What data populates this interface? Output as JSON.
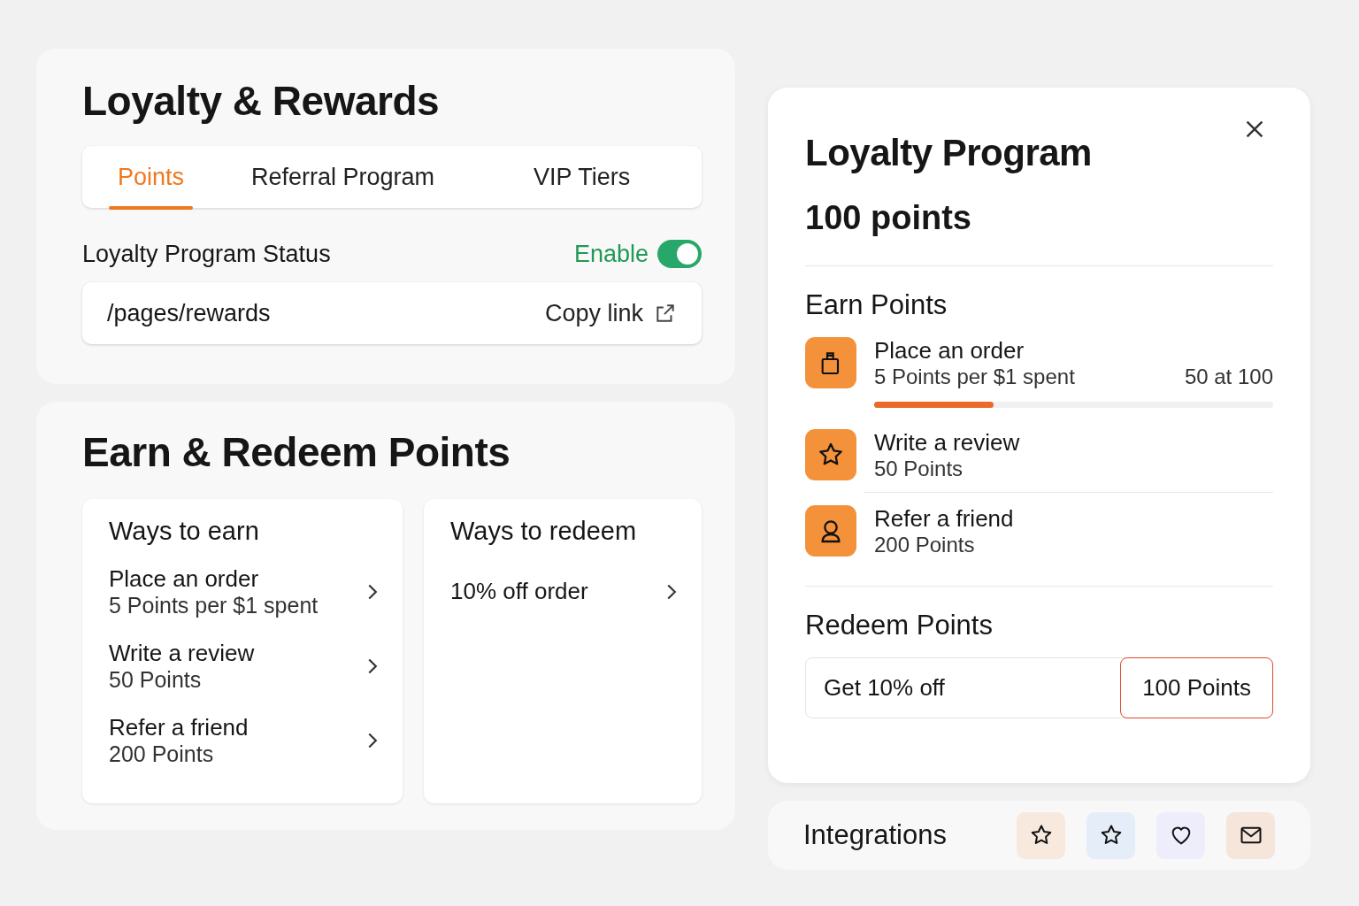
{
  "settings": {
    "title": "Loyalty & Rewards",
    "tabs": [
      {
        "label": "Points",
        "selected": true
      },
      {
        "label": "Referral Program",
        "selected": false
      },
      {
        "label": "VIP Tiers",
        "selected": false
      }
    ],
    "status": {
      "label": "Loyalty Program Status",
      "state_label": "Enable",
      "on": true
    },
    "link": {
      "value": "/pages/rewards",
      "action": "Copy link"
    }
  },
  "earn_redeem": {
    "title": "Earn & Redeem Points",
    "earn": {
      "title": "Ways to earn",
      "items": [
        {
          "title": "Place an order",
          "detail": "5 Points per $1 spent"
        },
        {
          "title": "Write a review",
          "detail": "50 Points"
        },
        {
          "title": "Refer a friend",
          "detail": "200 Points"
        }
      ]
    },
    "redeem": {
      "title": "Ways to redeem",
      "items": [
        {
          "title": "10% off order"
        }
      ]
    }
  },
  "preview": {
    "title": "Loyalty Program",
    "points": "100 points",
    "earn_title": "Earn Points",
    "earn_items": [
      {
        "kind": "bag",
        "title": "Place an order",
        "detail": "5 Points per $1 spent",
        "reading": "50 at 100",
        "level": 0.3
      },
      {
        "kind": "star",
        "title": "Write a review",
        "detail": "50 Points"
      },
      {
        "kind": "person",
        "title": "Refer a friend",
        "detail": "200 Points"
      }
    ],
    "redeem_title": "Redeem Points",
    "redeem": {
      "label": "Get 10% off",
      "cost": "100 Points"
    }
  },
  "integrations": {
    "title": "Integrations",
    "items": [
      {
        "kind": "star",
        "color": "#f8e9df"
      },
      {
        "kind": "star",
        "color": "#e5eef8"
      },
      {
        "kind": "heart",
        "color": "#eeedfc"
      },
      {
        "kind": "mail",
        "color": "#f5e5da"
      }
    ]
  }
}
